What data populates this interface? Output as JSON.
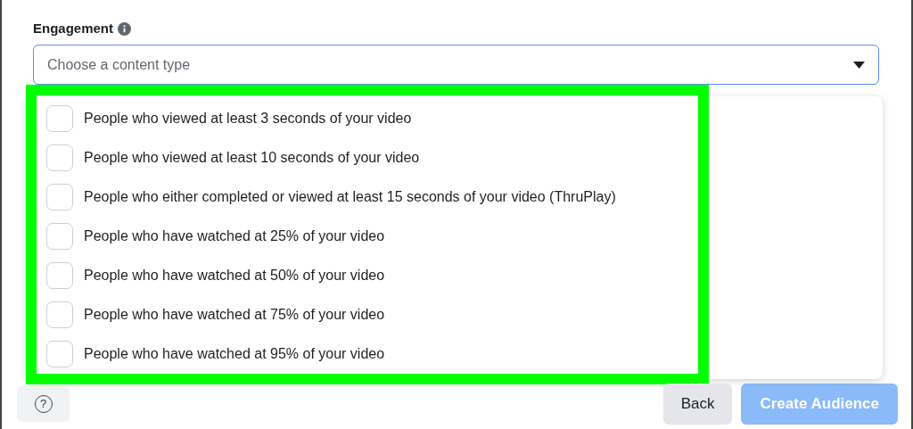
{
  "field": {
    "label": "Engagement",
    "placeholder": "Choose a content type"
  },
  "options": [
    {
      "label": "People who viewed at least 3 seconds of your video",
      "checked": false
    },
    {
      "label": "People who viewed at least 10 seconds of your video",
      "checked": false
    },
    {
      "label": "People who either completed or viewed at least 15 seconds of your video (ThruPlay)",
      "checked": false
    },
    {
      "label": "People who have watched at 25% of your video",
      "checked": false
    },
    {
      "label": "People who have watched at 50% of your video",
      "checked": false
    },
    {
      "label": "People who have watched at 75% of your video",
      "checked": false
    },
    {
      "label": "People who have watched at 95% of your video",
      "checked": false
    }
  ],
  "help_button": {
    "label": "?"
  },
  "buttons": [
    {
      "label": "Back",
      "disabled": false,
      "kind": "secondary"
    },
    {
      "label": "Create Audience",
      "disabled": true,
      "kind": "primary"
    }
  ]
}
